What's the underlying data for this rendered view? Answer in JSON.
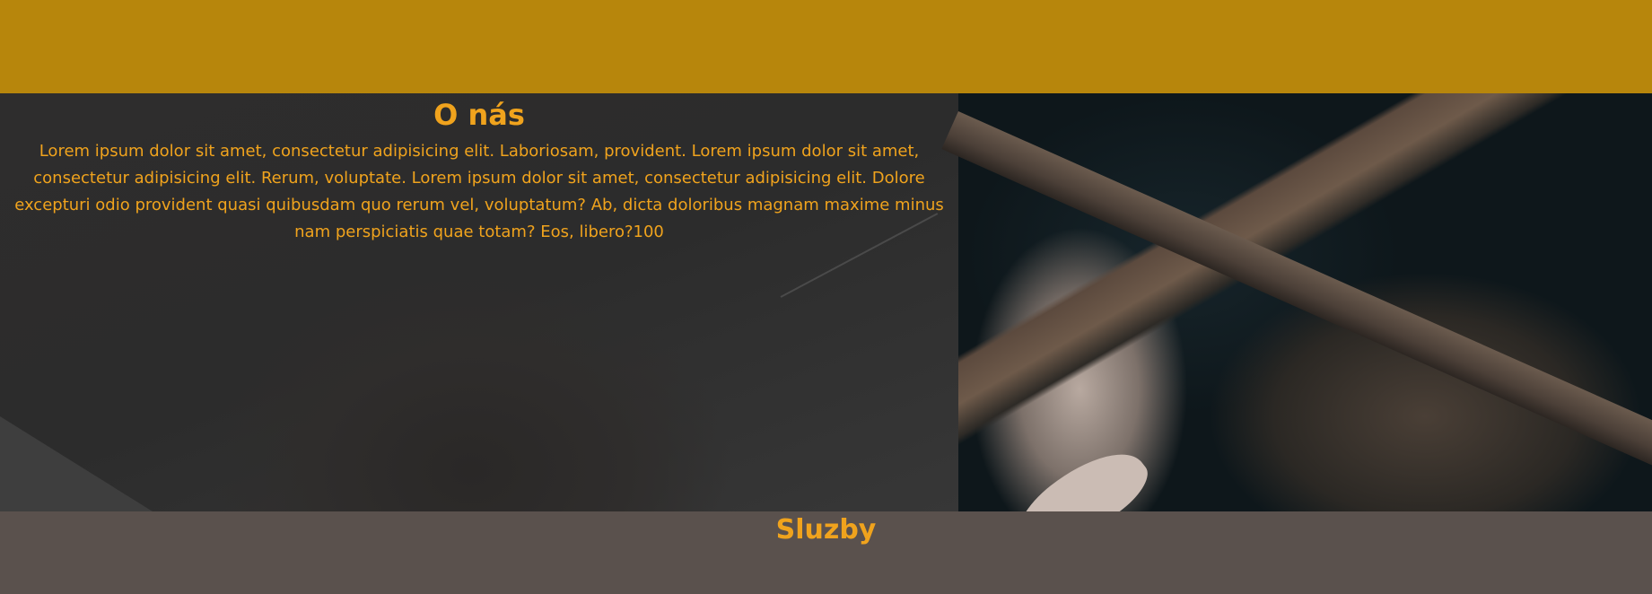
{
  "colors": {
    "header": "#b7860c",
    "accent_text": "#f0a31d",
    "services_bg": "#5a514d"
  },
  "about": {
    "title": "O nás",
    "body": "Lorem ipsum dolor sit amet, consectetur adipisicing elit. Laboriosam, provident. Lorem ipsum dolor sit amet, consectetur adipisicing elit. Rerum, voluptate. Lorem ipsum dolor sit amet, consectetur adipisicing elit. Dolore excepturi odio provident quasi quibusdam quo rerum vel, voluptatum? Ab, dicta doloribus magnam maxime minus nam perspiciatis quae totam? Eos, libero?100"
  },
  "services": {
    "title": "Sluzby"
  }
}
